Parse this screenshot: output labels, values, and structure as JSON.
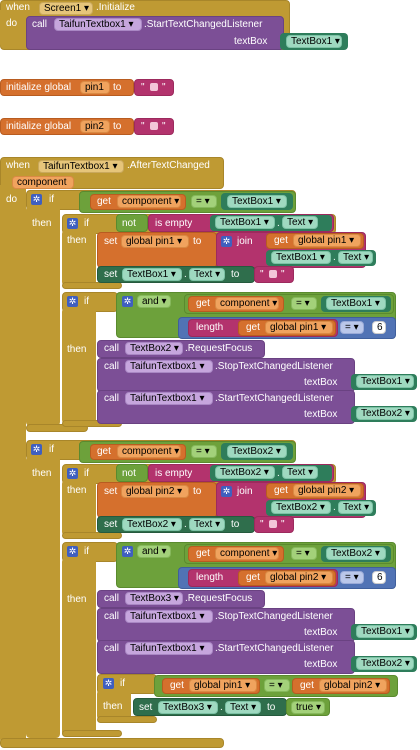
{
  "kw": {
    "when": "when",
    "do": "do",
    "call": "call",
    "init_global": "initialize global",
    "to": "to",
    "if": "if",
    "then": "then",
    "not": "not",
    "is_empty": "is empty",
    "get": "get",
    "set": "set",
    "join": "join",
    "and": "and",
    "length": "length",
    "true": "true",
    "textbox": "textBox",
    "dd": "▾",
    "quote": "\"",
    "dot": ".",
    "eq": "="
  },
  "screen1_event": {
    "component": "Screen1",
    "event": ".Initialize",
    "call_comp": "TaifunTextbox1",
    "call_method": ".StartTextChangedListener",
    "arg_value": "TextBox1"
  },
  "globals": [
    {
      "name": "pin1"
    },
    {
      "name": "pin2"
    }
  ],
  "after_event": {
    "component": "TaifunTextbox1",
    "event": ".AfterTextChanged",
    "param": "component"
  },
  "ids": {
    "component": "component",
    "textbox1": "TextBox1",
    "textbox2": "TextBox2",
    "textbox3": "TextBox3",
    "taifun": "TaifunTextbox1",
    "text_prop": "Text",
    "global_pin1": "global pin1",
    "global_pin2": "global pin2",
    "request_focus": ".RequestFocus",
    "stop": ".StopTextChangedListener",
    "start": ".StartTextChangedListener",
    "len_val": "6"
  },
  "colors": {
    "event": "#bf9a33",
    "procedure": "#7c4f96",
    "variable": "#d5702d",
    "logic": "#6da13b",
    "math": "#5173b5",
    "text": "#b3336d"
  }
}
